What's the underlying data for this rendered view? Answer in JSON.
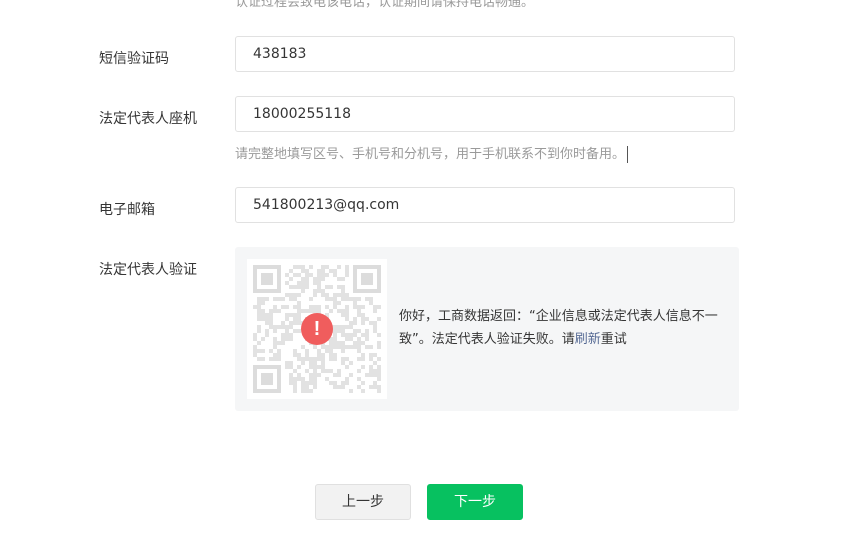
{
  "top_hint": "认证过程会致电该电话，认证期间请保持电话畅通。",
  "sms_code": {
    "label": "短信验证码",
    "value": "438183"
  },
  "landline": {
    "label": "法定代表人座机",
    "value": "18000255118",
    "hint": "请完整地填写区号、手机号和分机号，用于手机联系不到你时备用。"
  },
  "email": {
    "label": "电子邮箱",
    "value": "541800213@qq.com"
  },
  "legal_verify": {
    "label": "法定代表人验证",
    "qr_icon": "qr-code-icon",
    "status_icon": "error-icon",
    "error_glyph": "!",
    "message_prefix": "你好，工商数据返回：“企业信息或法定代表人信息不一致”。法定代表人验证失败。请",
    "refresh_link": "刷新",
    "message_suffix": "重试"
  },
  "buttons": {
    "prev": "上一步",
    "next": "下一步"
  },
  "colors": {
    "primary": "#07c160",
    "error": "#f05d5d",
    "link": "#576b95"
  }
}
